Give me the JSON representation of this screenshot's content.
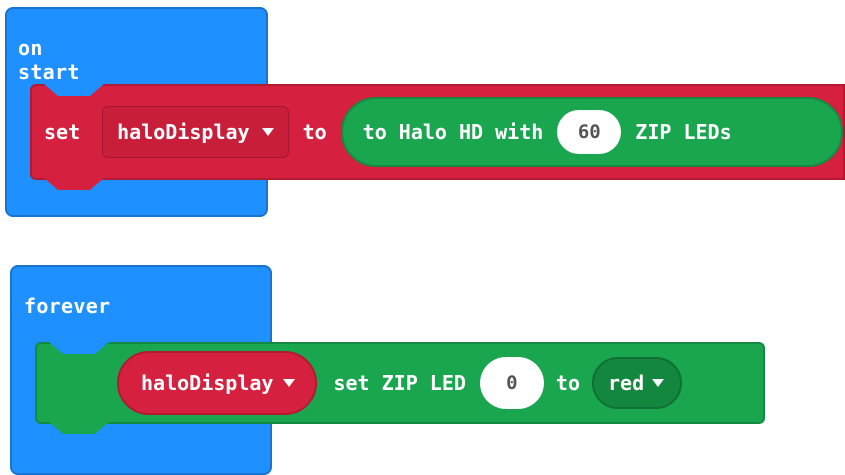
{
  "on_start": {
    "label": "on start",
    "set_block": {
      "set_label": "set",
      "variable": "haloDisplay",
      "to_label": "to",
      "create": {
        "prefix": "to Halo HD with",
        "count": "60",
        "suffix": "ZIP LEDs"
      }
    }
  },
  "forever": {
    "label": "forever",
    "zip_block": {
      "variable": "haloDisplay",
      "action": "set ZIP LED",
      "index": "0",
      "to_label": "to",
      "color": "red"
    }
  },
  "colors": {
    "event_blue": "#1e90ff",
    "variable_red": "#d5213f",
    "zip_green": "#1aa54f"
  }
}
